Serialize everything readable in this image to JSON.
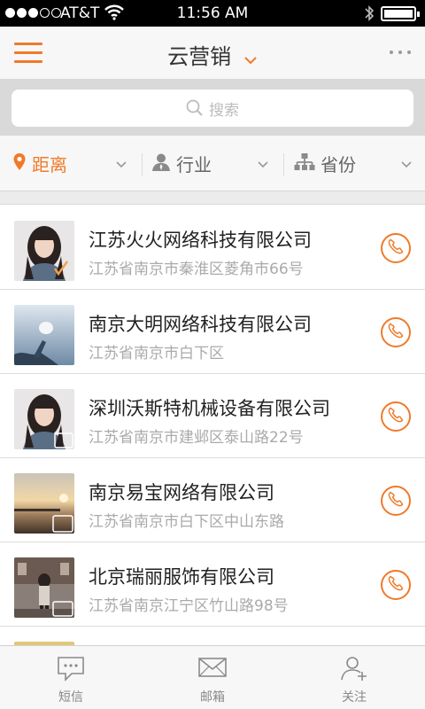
{
  "status_bar": {
    "carrier": "AT&T",
    "time": "11:56 AM"
  },
  "nav": {
    "title": "云营销"
  },
  "search": {
    "placeholder": "搜索"
  },
  "filters": [
    {
      "label": "距离",
      "icon": "location-pin-icon",
      "active": true
    },
    {
      "label": "行业",
      "icon": "person-icon",
      "active": false
    },
    {
      "label": "省份",
      "icon": "hierarchy-icon",
      "active": false
    }
  ],
  "companies": [
    {
      "name": "江苏火火网络科技有限公司",
      "address": "江苏省南京市秦淮区菱角市66号",
      "avatar": "girl-portrait"
    },
    {
      "name": "南京大明网络科技有限公司",
      "address": "江苏省南京市白下区",
      "avatar": "sky-photo"
    },
    {
      "name": "深圳沃斯特机械设备有限公司",
      "address": "江苏省南京市建邺区泰山路22号",
      "avatar": "girl-portrait"
    },
    {
      "name": "南京易宝网络有限公司",
      "address": "江苏省南京市白下区中山东路",
      "avatar": "sunset-photo"
    },
    {
      "name": "北京瑞丽服饰有限公司",
      "address": "江苏省南京江宁区竹山路98号",
      "avatar": "street-photo"
    }
  ],
  "tabs": [
    {
      "label": "短信",
      "icon": "message-icon"
    },
    {
      "label": "邮箱",
      "icon": "mail-icon"
    },
    {
      "label": "关注",
      "icon": "add-contact-icon"
    }
  ],
  "colors": {
    "accent": "#f07a2a",
    "text_primary": "#222222",
    "text_secondary": "#aaaaaa"
  }
}
